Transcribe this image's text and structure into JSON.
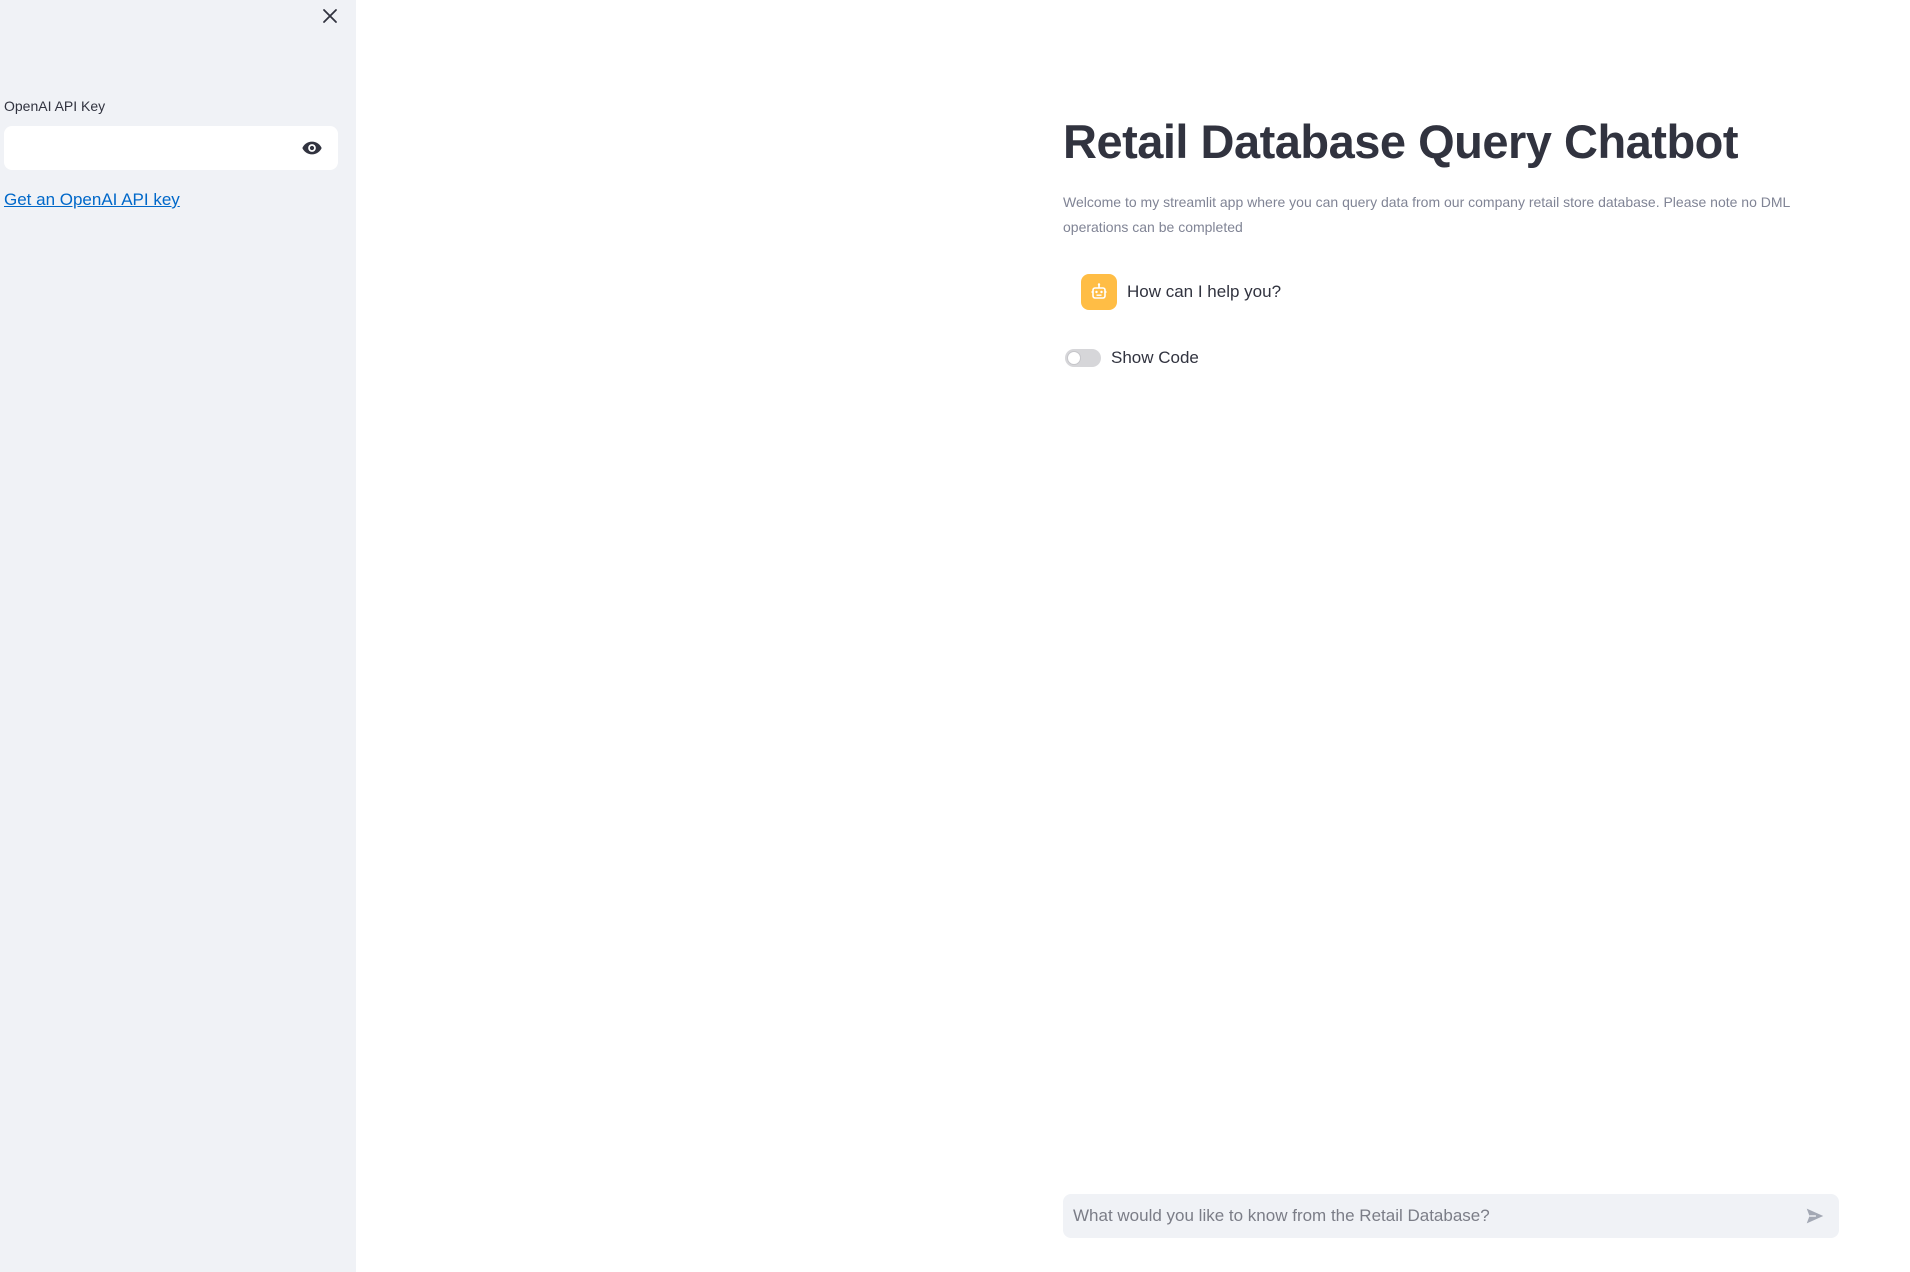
{
  "sidebar": {
    "api_key_label": "OpenAI API Key",
    "api_key_value": "",
    "api_key_link": "Get an OpenAI API key"
  },
  "main": {
    "title": "Retail Database Query Chatbot",
    "description": "Welcome to my streamlit app where you can query data from our company retail store database. Please note no DML operations can be completed",
    "messages": [
      {
        "role": "assistant",
        "text": "How can I help you?"
      }
    ],
    "toggle": {
      "label": "Show Code",
      "checked": false
    },
    "chat_input": {
      "placeholder": "What would you like to know from the Retail Database?",
      "value": ""
    }
  },
  "colors": {
    "sidebar_bg": "#f0f2f6",
    "accent_avatar": "#ffbd45",
    "link": "#0068c9",
    "text": "#31333f",
    "muted_text": "#808495"
  },
  "icons": {
    "close": "close-icon",
    "eye": "eye-icon",
    "bot": "robot-icon",
    "send": "send-icon"
  }
}
